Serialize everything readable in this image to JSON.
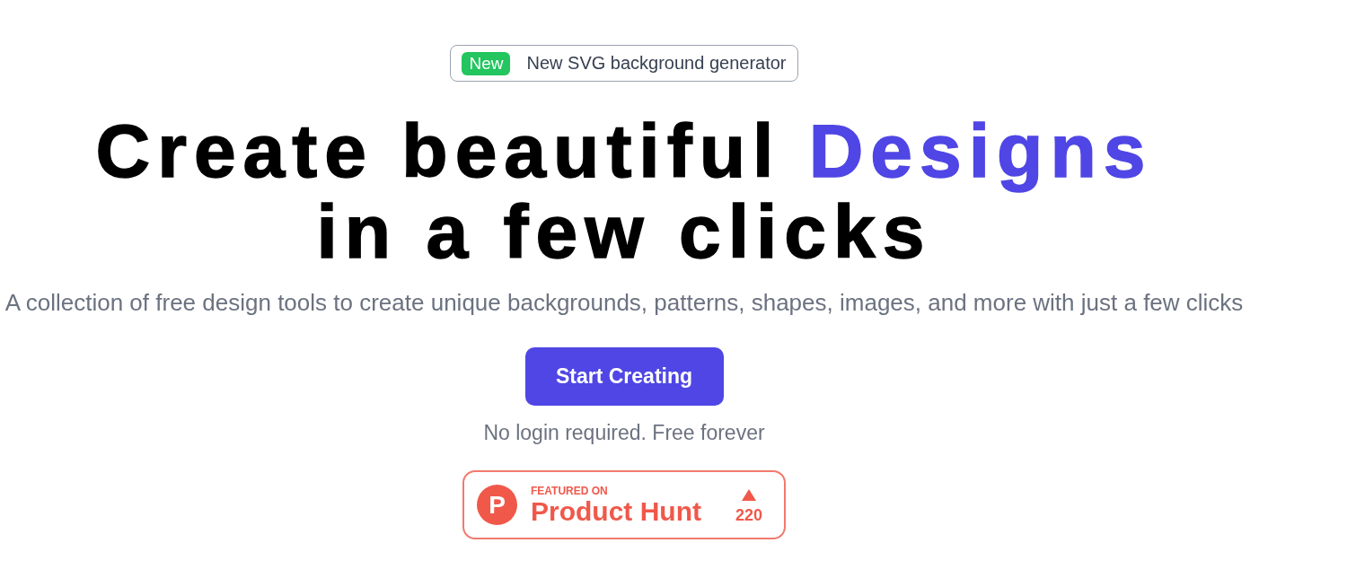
{
  "announcement": {
    "tag": "New",
    "text": "New SVG background generator"
  },
  "headline": {
    "lines": [
      [
        {
          "text": "Create beautiful ",
          "accent": false
        },
        {
          "text": "Designs",
          "accent": true
        }
      ],
      [
        {
          "text": "in a few clicks",
          "accent": false
        }
      ]
    ]
  },
  "subtitle": "A collection of free design tools to create unique backgrounds, patterns, shapes, images, and more with just a few clicks",
  "cta": {
    "label": "Start Creating"
  },
  "note": "No login required. Free forever",
  "product_hunt": {
    "logo_letter": "P",
    "eyebrow": "FEATURED ON",
    "name": "Product Hunt",
    "votes": "220"
  }
}
